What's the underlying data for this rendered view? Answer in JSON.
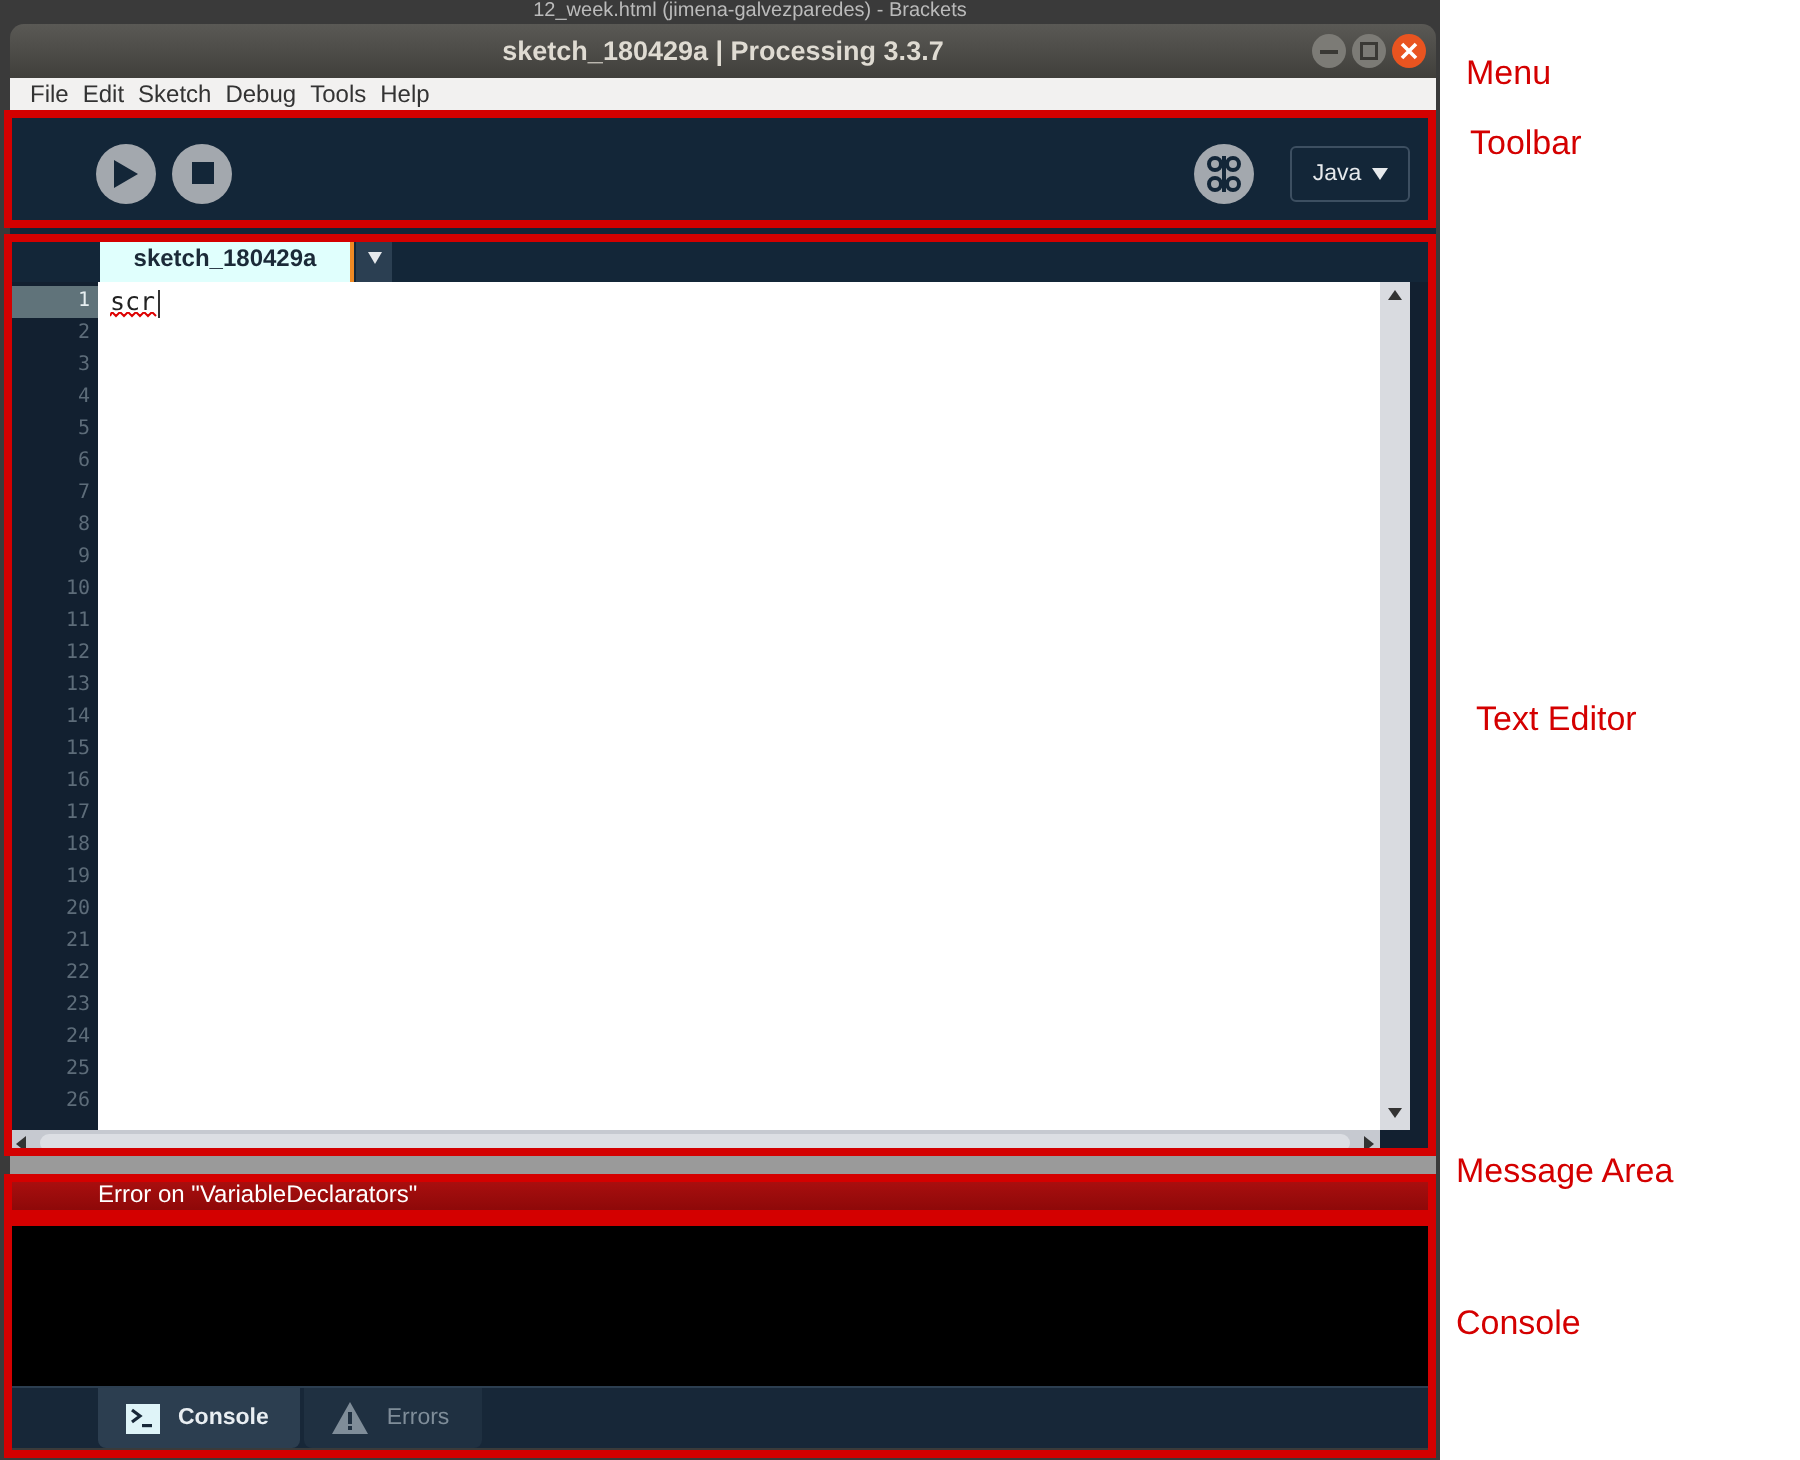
{
  "background_window": {
    "title": "12_week.html (jimena-galvezparedes) - Brackets"
  },
  "window": {
    "title": "sketch_180429a | Processing 3.3.7"
  },
  "menu": [
    {
      "label": "File"
    },
    {
      "label": "Edit"
    },
    {
      "label": "Sketch"
    },
    {
      "label": "Debug"
    },
    {
      "label": "Tools"
    },
    {
      "label": "Help"
    }
  ],
  "toolbar": {
    "mode": "Java"
  },
  "editor": {
    "tabs": [
      {
        "label": "sketch_180429a",
        "selected": true
      }
    ],
    "lines": [
      {
        "number": "1",
        "text": "scr",
        "current": true,
        "error": true
      },
      {
        "number": "2",
        "current": false,
        "error": false
      },
      {
        "number": "3",
        "current": false,
        "error": false
      },
      {
        "number": "4",
        "current": false,
        "error": false
      },
      {
        "number": "5",
        "current": false,
        "error": false
      },
      {
        "number": "6",
        "current": false,
        "error": false
      },
      {
        "number": "7",
        "current": false,
        "error": false
      },
      {
        "number": "8",
        "current": false,
        "error": false
      },
      {
        "number": "9",
        "current": false,
        "error": false
      },
      {
        "number": "10",
        "current": false,
        "error": false
      },
      {
        "number": "11",
        "current": false,
        "error": false
      },
      {
        "number": "12",
        "current": false,
        "error": false
      },
      {
        "number": "13",
        "current": false,
        "error": false
      },
      {
        "number": "14",
        "current": false,
        "error": false
      },
      {
        "number": "15",
        "current": false,
        "error": false
      },
      {
        "number": "16",
        "current": false,
        "error": false
      },
      {
        "number": "17",
        "current": false,
        "error": false
      },
      {
        "number": "18",
        "current": false,
        "error": false
      },
      {
        "number": "19",
        "current": false,
        "error": false
      },
      {
        "number": "20",
        "current": false,
        "error": false
      },
      {
        "number": "21",
        "current": false,
        "error": false
      },
      {
        "number": "22",
        "current": false,
        "error": false
      },
      {
        "number": "23",
        "current": false,
        "error": false
      },
      {
        "number": "24",
        "current": false,
        "error": false
      },
      {
        "number": "25",
        "current": false,
        "error": false
      },
      {
        "number": "26",
        "current": false,
        "error": false
      }
    ]
  },
  "message": {
    "text": "Error on \"VariableDeclarators\""
  },
  "console_tabs": [
    {
      "label": "Console",
      "kind": "console",
      "selected": true
    },
    {
      "label": "Errors",
      "kind": "errors",
      "selected": false
    }
  ],
  "annotations": [
    {
      "label": "Menu",
      "kind": "menu"
    },
    {
      "label": "Toolbar",
      "kind": "toolbar"
    },
    {
      "label": "Text Editor",
      "kind": "editor"
    },
    {
      "label": "Message Area",
      "kind": "message"
    },
    {
      "label": "Console",
      "kind": "console"
    }
  ]
}
